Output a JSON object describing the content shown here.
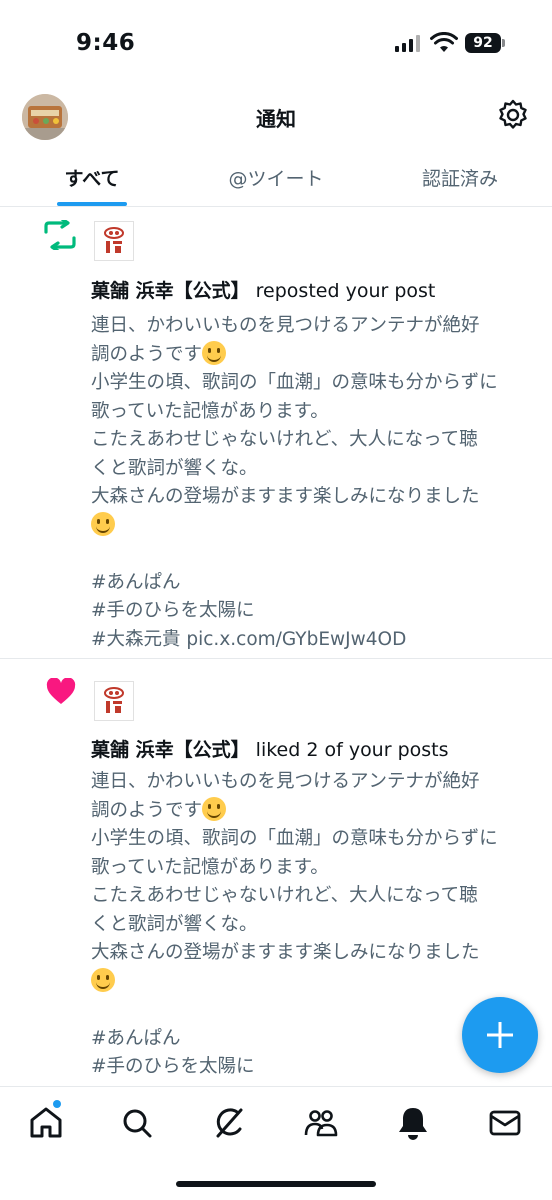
{
  "status_bar": {
    "time": "9:46",
    "battery": "92"
  },
  "header": {
    "title": "通知"
  },
  "tabs": [
    {
      "label": "すべて",
      "active": true
    },
    {
      "label": "@ツイート",
      "active": false
    },
    {
      "label": "認証済み",
      "active": false
    }
  ],
  "notifications": [
    {
      "icon": "repost-icon",
      "account": "菓舗 浜幸【公式】",
      "action": " reposted your post",
      "lines": [
        "連日、かわいいものを見つけるアンテナが絶好",
        "調のようです",
        "小学生の頃、歌詞の「血潮」の意味も分からずに",
        "歌っていた記憶があります。",
        "こたえあわせじゃないけれど、大人になって聴",
        "くと歌詞が響くな。",
        "大森さんの登場がますます楽しみになりました",
        "",
        "",
        "#あんぱん",
        "#手のひらを太陽に",
        "#大森元貴 pic.x.com/GYbEwJw4OD"
      ]
    },
    {
      "icon": "heart-icon",
      "account": "菓舗 浜幸【公式】",
      "action": " liked 2 of your posts",
      "lines": [
        "連日、かわいいものを見つけるアンテナが絶好",
        "調のようです",
        "小学生の頃、歌詞の「血潮」の意味も分からずに",
        "歌っていた記憶があります。",
        "こたえあわせじゃないけれど、大人になって聴",
        "くと歌詞が響くな。",
        "大森さんの登場がますます楽しみになりました",
        "",
        "",
        "#あんぱん",
        "#手のひらを太陽に"
      ]
    }
  ],
  "colors": {
    "accent": "#1d9bf0",
    "repost": "#00ba7c",
    "like": "#f91880",
    "secondary_text": "#536471"
  },
  "nav_icons": [
    "home-icon",
    "search-icon",
    "grok-icon",
    "communities-icon",
    "notifications-icon",
    "messages-icon"
  ]
}
